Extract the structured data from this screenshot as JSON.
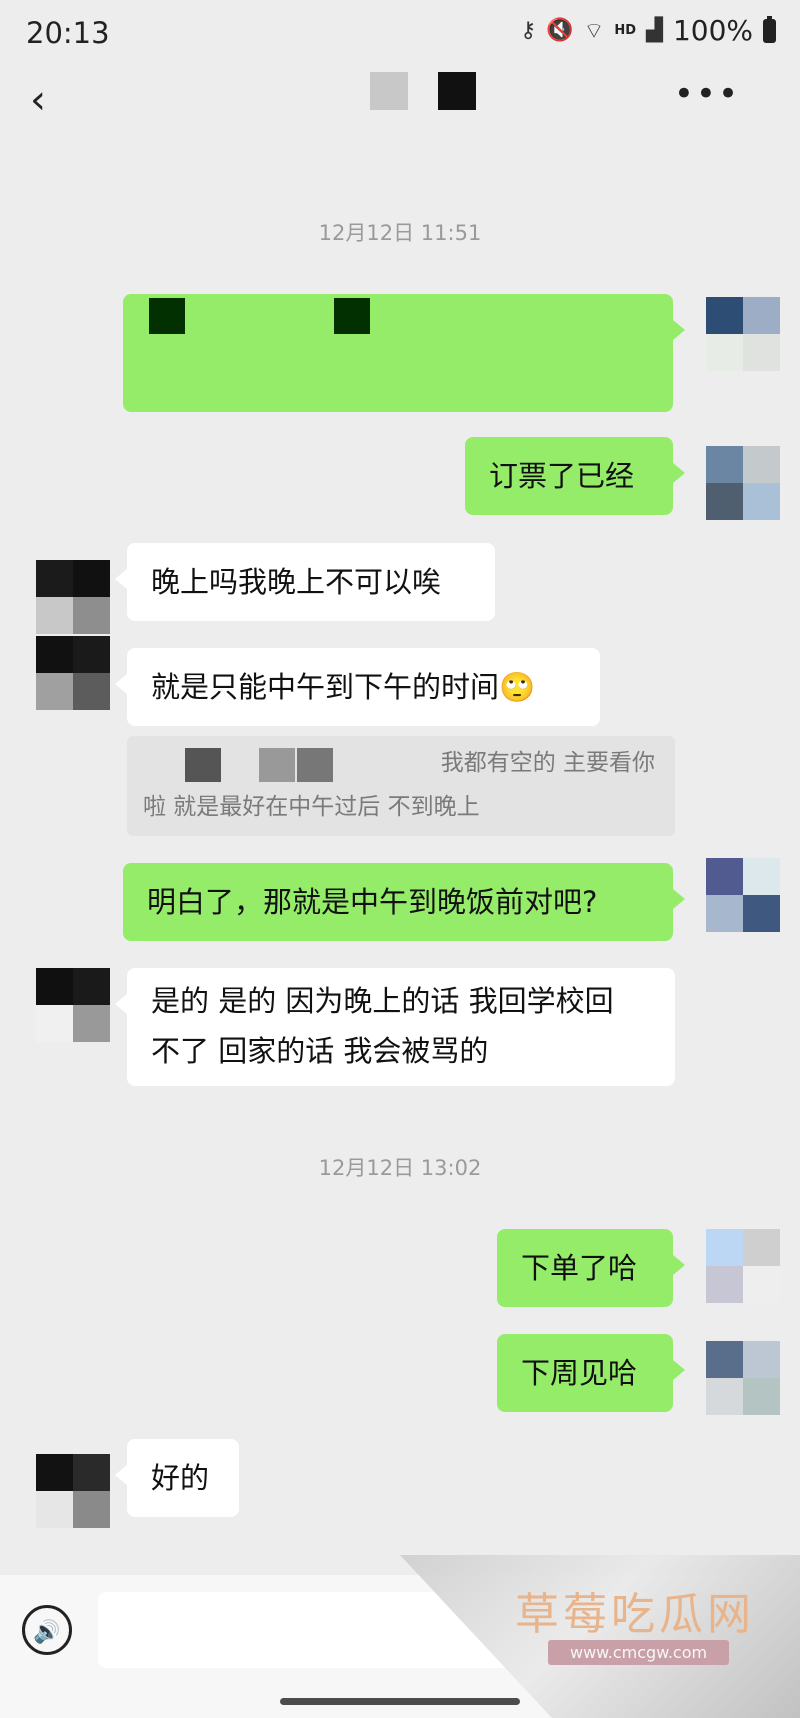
{
  "status_bar": {
    "time": "20:13",
    "battery": "100%",
    "network": "HD",
    "icons": [
      "key-icon",
      "mute-icon",
      "wifi-icon",
      "signal-icon",
      "battery-icon"
    ]
  },
  "header": {
    "back_icon": "chevron-left-icon",
    "more_icon": "more-dots-icon",
    "title_blocks": [
      "#c8c8c8",
      "#111111"
    ]
  },
  "timestamps": [
    "12月12日 11:51",
    "12月12日 13:02"
  ],
  "messages": [
    {
      "side": "right",
      "text": ""
    },
    {
      "side": "right",
      "text": "订票了已经"
    },
    {
      "side": "left",
      "text": "晚上吗我晚上不可以唉"
    },
    {
      "side": "left",
      "text": "就是只能中午到下午的时间🙄"
    },
    {
      "side": "left-quote",
      "text": "我都有空的 主要看你",
      "text2": "啦 就是最好在中午过后 不到晚上"
    },
    {
      "side": "right",
      "text": "明白了，那就是中午到晚饭前对吧?"
    },
    {
      "side": "left",
      "text": "是的 是的 因为晚上的话 我回学校回",
      "text2": "不了 回家的话 我会被骂的"
    },
    {
      "side": "right",
      "text": "下单了哈"
    },
    {
      "side": "right",
      "text": "下周见哈"
    },
    {
      "side": "left",
      "text": "好的"
    }
  ],
  "input": {
    "placeholder": "",
    "voice_icon": "voice-icon"
  },
  "watermark": {
    "title": "草莓吃瓜网",
    "url": "www.cmcgw.com"
  },
  "colors": {
    "background": "#ededed",
    "sent_bubble": "#95ec69",
    "received_bubble": "#ffffff"
  }
}
